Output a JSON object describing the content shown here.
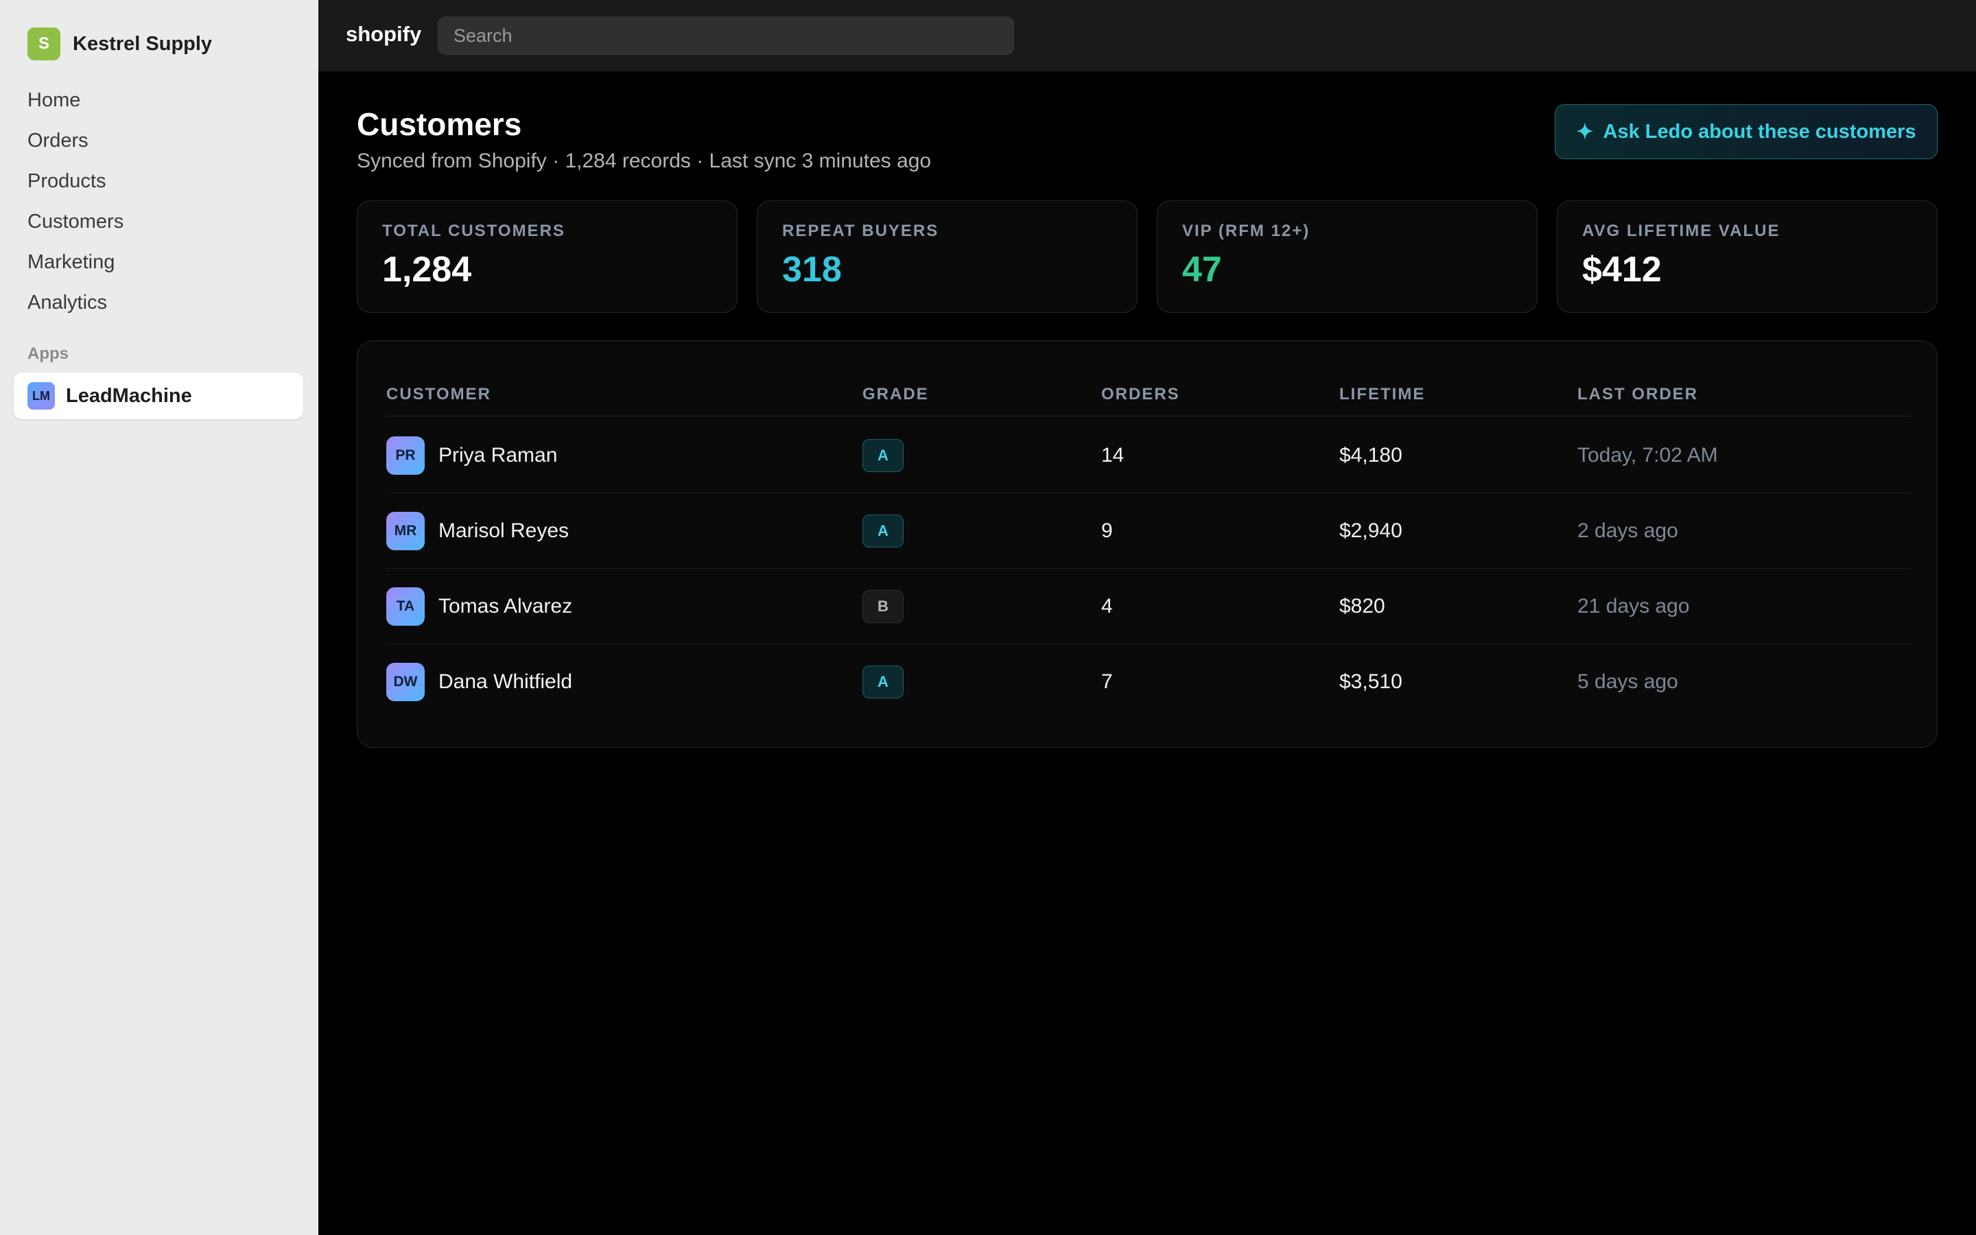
{
  "colors": {
    "accent": "#3ad3e6",
    "repeat": "#35c6e0",
    "vip": "#34c98e",
    "store_logo": "#8fbf45"
  },
  "sidebar": {
    "store": {
      "initial": "S",
      "name": "Kestrel Supply"
    },
    "nav": [
      {
        "label": "Home"
      },
      {
        "label": "Orders"
      },
      {
        "label": "Products"
      },
      {
        "label": "Customers"
      },
      {
        "label": "Marketing"
      },
      {
        "label": "Analytics"
      }
    ],
    "apps_label": "Apps",
    "apps": [
      {
        "initials": "LM",
        "label": "LeadMachine"
      }
    ]
  },
  "topbar": {
    "brand": "shopify",
    "search_placeholder": "Search"
  },
  "page": {
    "title": "Customers",
    "subtitle": "Synced from Shopify · 1,284 records · Last sync 3 minutes ago",
    "ask_button": {
      "icon": "sparkle-icon",
      "label": "Ask Ledo about these customers"
    }
  },
  "stats": [
    {
      "label": "TOTAL CUSTOMERS",
      "value": "1,284",
      "color": "#ffffff"
    },
    {
      "label": "REPEAT BUYERS",
      "value": "318",
      "color": "#35c6e0"
    },
    {
      "label": "VIP (RFM 12+)",
      "value": "47",
      "color": "#34c98e"
    },
    {
      "label": "AVG LIFETIME VALUE",
      "value": "$412",
      "color": "#ffffff"
    }
  ],
  "table": {
    "columns": [
      "CUSTOMER",
      "GRADE",
      "ORDERS",
      "LIFETIME",
      "LAST ORDER"
    ],
    "rows": [
      {
        "initials": "PR",
        "name": "Priya Raman",
        "grade": "A",
        "orders": "14",
        "lifetime": "$4,180",
        "last_order": "Today, 7:02 AM"
      },
      {
        "initials": "MR",
        "name": "Marisol Reyes",
        "grade": "A",
        "orders": "9",
        "lifetime": "$2,940",
        "last_order": "2 days ago"
      },
      {
        "initials": "TA",
        "name": "Tomas Alvarez",
        "grade": "B",
        "orders": "4",
        "lifetime": "$820",
        "last_order": "21 days ago"
      },
      {
        "initials": "DW",
        "name": "Dana Whitfield",
        "grade": "A",
        "orders": "7",
        "lifetime": "$3,510",
        "last_order": "5 days ago"
      }
    ]
  }
}
